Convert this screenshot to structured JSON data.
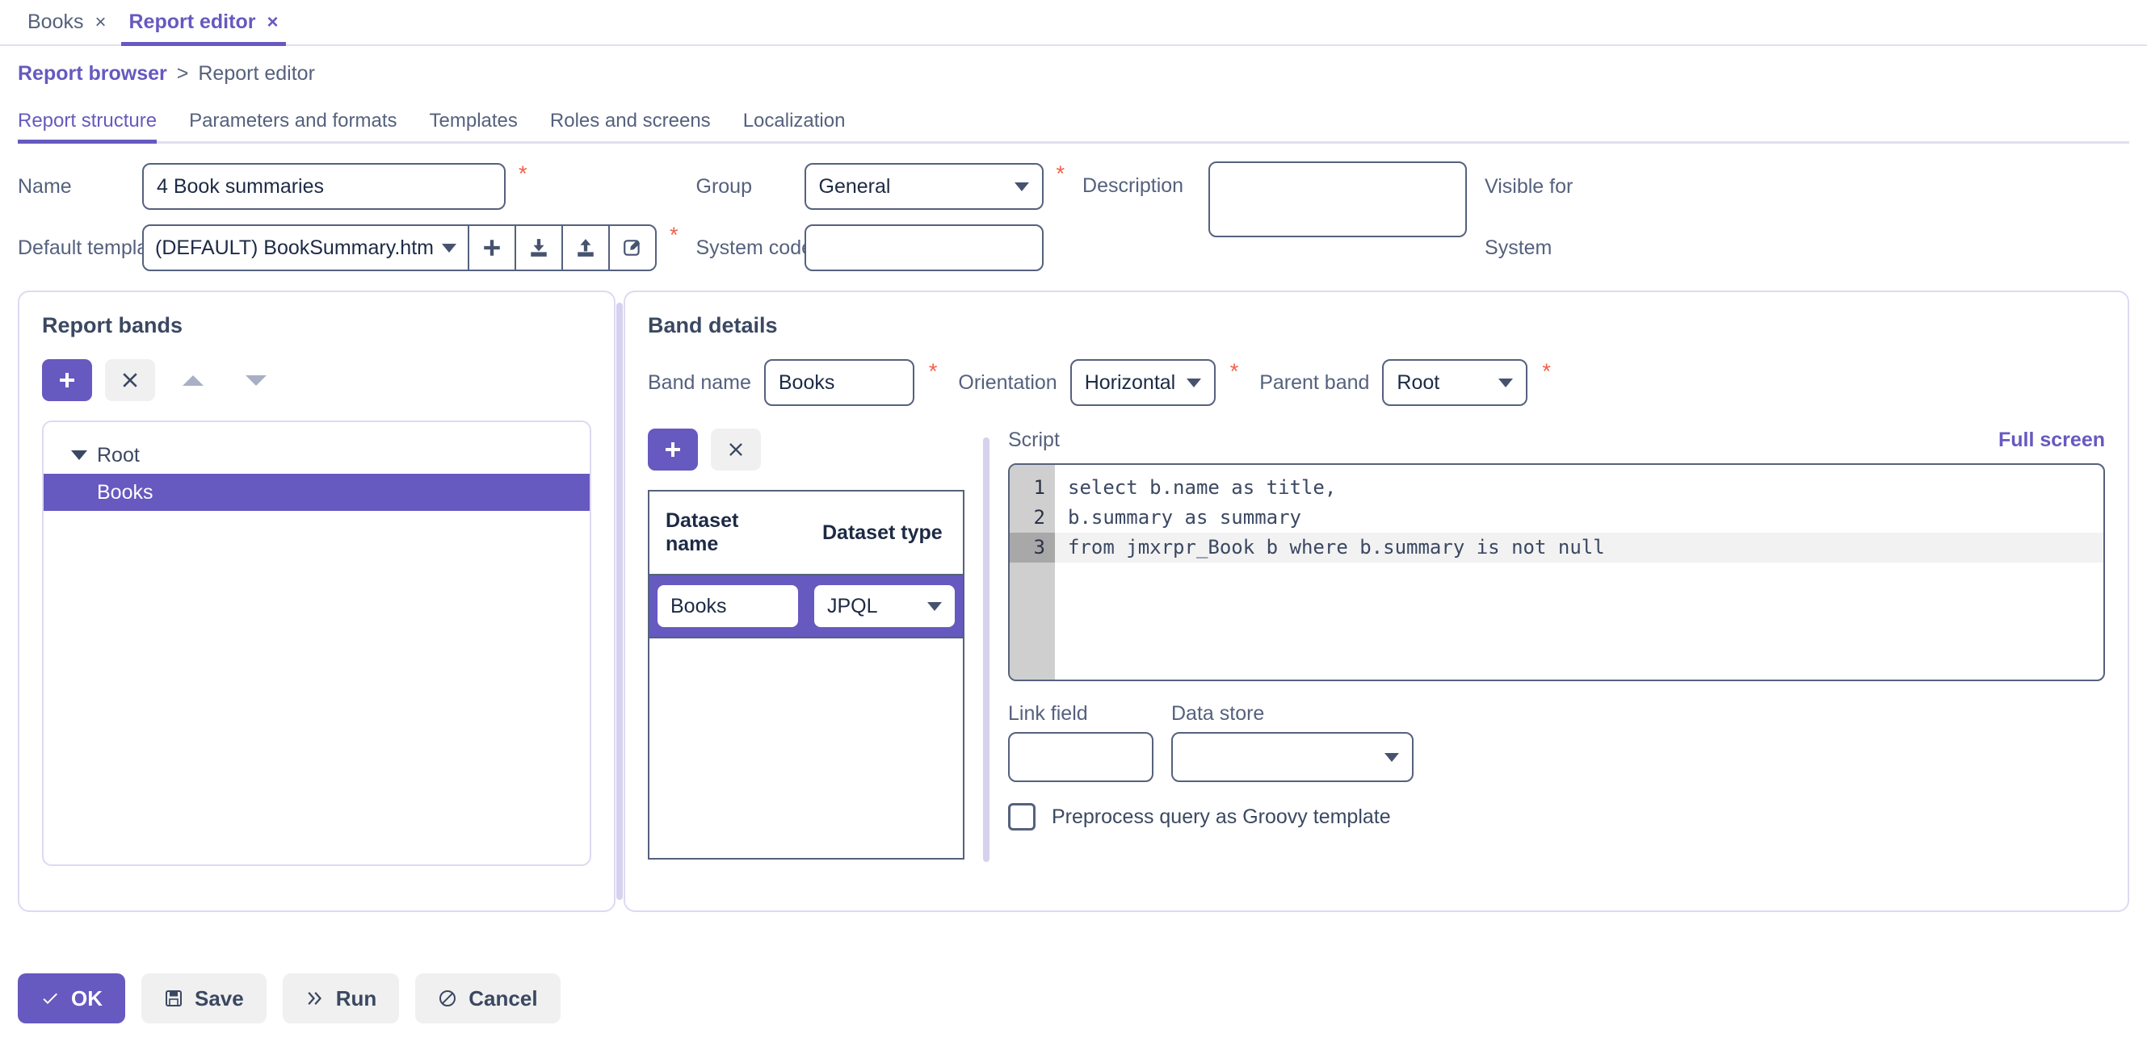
{
  "colors": {
    "accent": "#6659c0",
    "text": "#43506b",
    "required": "#f0604b",
    "panel_border": "#ded9f2",
    "control_border": "#55617d",
    "ghost_button": "#f0f0f0"
  },
  "browser_tabs": [
    {
      "label": "Books",
      "active": false,
      "close": "×"
    },
    {
      "label": "Report editor",
      "active": true,
      "close": "×"
    }
  ],
  "breadcrumb": {
    "parent": "Report browser",
    "separator": ">",
    "current": "Report editor"
  },
  "section_tabs": [
    {
      "label": "Report structure",
      "active": true
    },
    {
      "label": "Parameters and formats",
      "active": false
    },
    {
      "label": "Templates",
      "active": false
    },
    {
      "label": "Roles and screens",
      "active": false
    },
    {
      "label": "Localization",
      "active": false
    }
  ],
  "header_form": {
    "name": {
      "label": "Name",
      "value": "4 Book summaries",
      "required": "*"
    },
    "default_template": {
      "label": "Default template",
      "value": "(DEFAULT) BookSummary.htm",
      "required": "*",
      "buttons": [
        {
          "name": "create-template",
          "icon": "plus-icon"
        },
        {
          "name": "download-template",
          "icon": "download-icon"
        },
        {
          "name": "upload-template",
          "icon": "upload-icon"
        },
        {
          "name": "edit-template",
          "icon": "edit-icon"
        }
      ]
    },
    "group": {
      "label": "Group",
      "value": "General",
      "required": "*"
    },
    "system_code": {
      "label": "System code",
      "value": "",
      "required": "*"
    },
    "description": {
      "label": "Description",
      "value": ""
    },
    "visible_for": {
      "label": "Visible for"
    },
    "system": {
      "label": "System"
    }
  },
  "report_bands": {
    "title": "Report bands",
    "toolbar": [
      {
        "name": "add-band-button",
        "icon": "plus-icon",
        "style": "primary"
      },
      {
        "name": "remove-band-button",
        "icon": "close-icon",
        "style": "ghost"
      },
      {
        "name": "move-band-up-button",
        "icon": "triangle-up-icon",
        "style": "arrow"
      },
      {
        "name": "move-band-down-button",
        "icon": "triangle-down-icon",
        "style": "arrow"
      }
    ],
    "tree": {
      "root": "Root",
      "children": [
        {
          "label": "Books",
          "selected": true
        }
      ]
    }
  },
  "band_details": {
    "title": "Band details",
    "band_name": {
      "label": "Band name",
      "value": "Books",
      "required": "*"
    },
    "orientation": {
      "label": "Orientation",
      "value": "Horizontal",
      "required": "*"
    },
    "parent_band": {
      "label": "Parent band",
      "value": "Root",
      "required": "*"
    },
    "dataset_toolbar": [
      {
        "name": "add-dataset-button",
        "icon": "plus-icon",
        "style": "primary"
      },
      {
        "name": "remove-dataset-button",
        "icon": "close-icon",
        "style": "ghost"
      }
    ],
    "dataset_table": {
      "columns": [
        "Dataset name",
        "Dataset type"
      ],
      "rows": [
        {
          "name": "Books",
          "type": "JPQL",
          "selected": true
        }
      ]
    },
    "script": {
      "label": "Script",
      "full_screen_label": "Full screen",
      "current_line": 3,
      "lines": [
        {
          "no": "1",
          "text": "select b.name as title,"
        },
        {
          "no": "2",
          "text": "b.summary as summary"
        },
        {
          "no": "3",
          "text": "from jmxrpr_Book b where b.summary is not null"
        }
      ]
    },
    "link_field": {
      "label": "Link field",
      "value": ""
    },
    "data_store": {
      "label": "Data store",
      "value": ""
    },
    "preprocess": {
      "label": "Preprocess query as Groovy template",
      "checked": false
    }
  },
  "footer_buttons": [
    {
      "name": "ok-button",
      "label": "OK",
      "icon": "check-icon",
      "style": "primary"
    },
    {
      "name": "save-button",
      "label": "Save",
      "icon": "floppy-icon",
      "style": "ghost"
    },
    {
      "name": "run-button",
      "label": "Run",
      "icon": "chevrons-right-icon",
      "style": "ghost"
    },
    {
      "name": "cancel-button",
      "label": "Cancel",
      "icon": "ban-icon",
      "style": "ghost"
    }
  ]
}
